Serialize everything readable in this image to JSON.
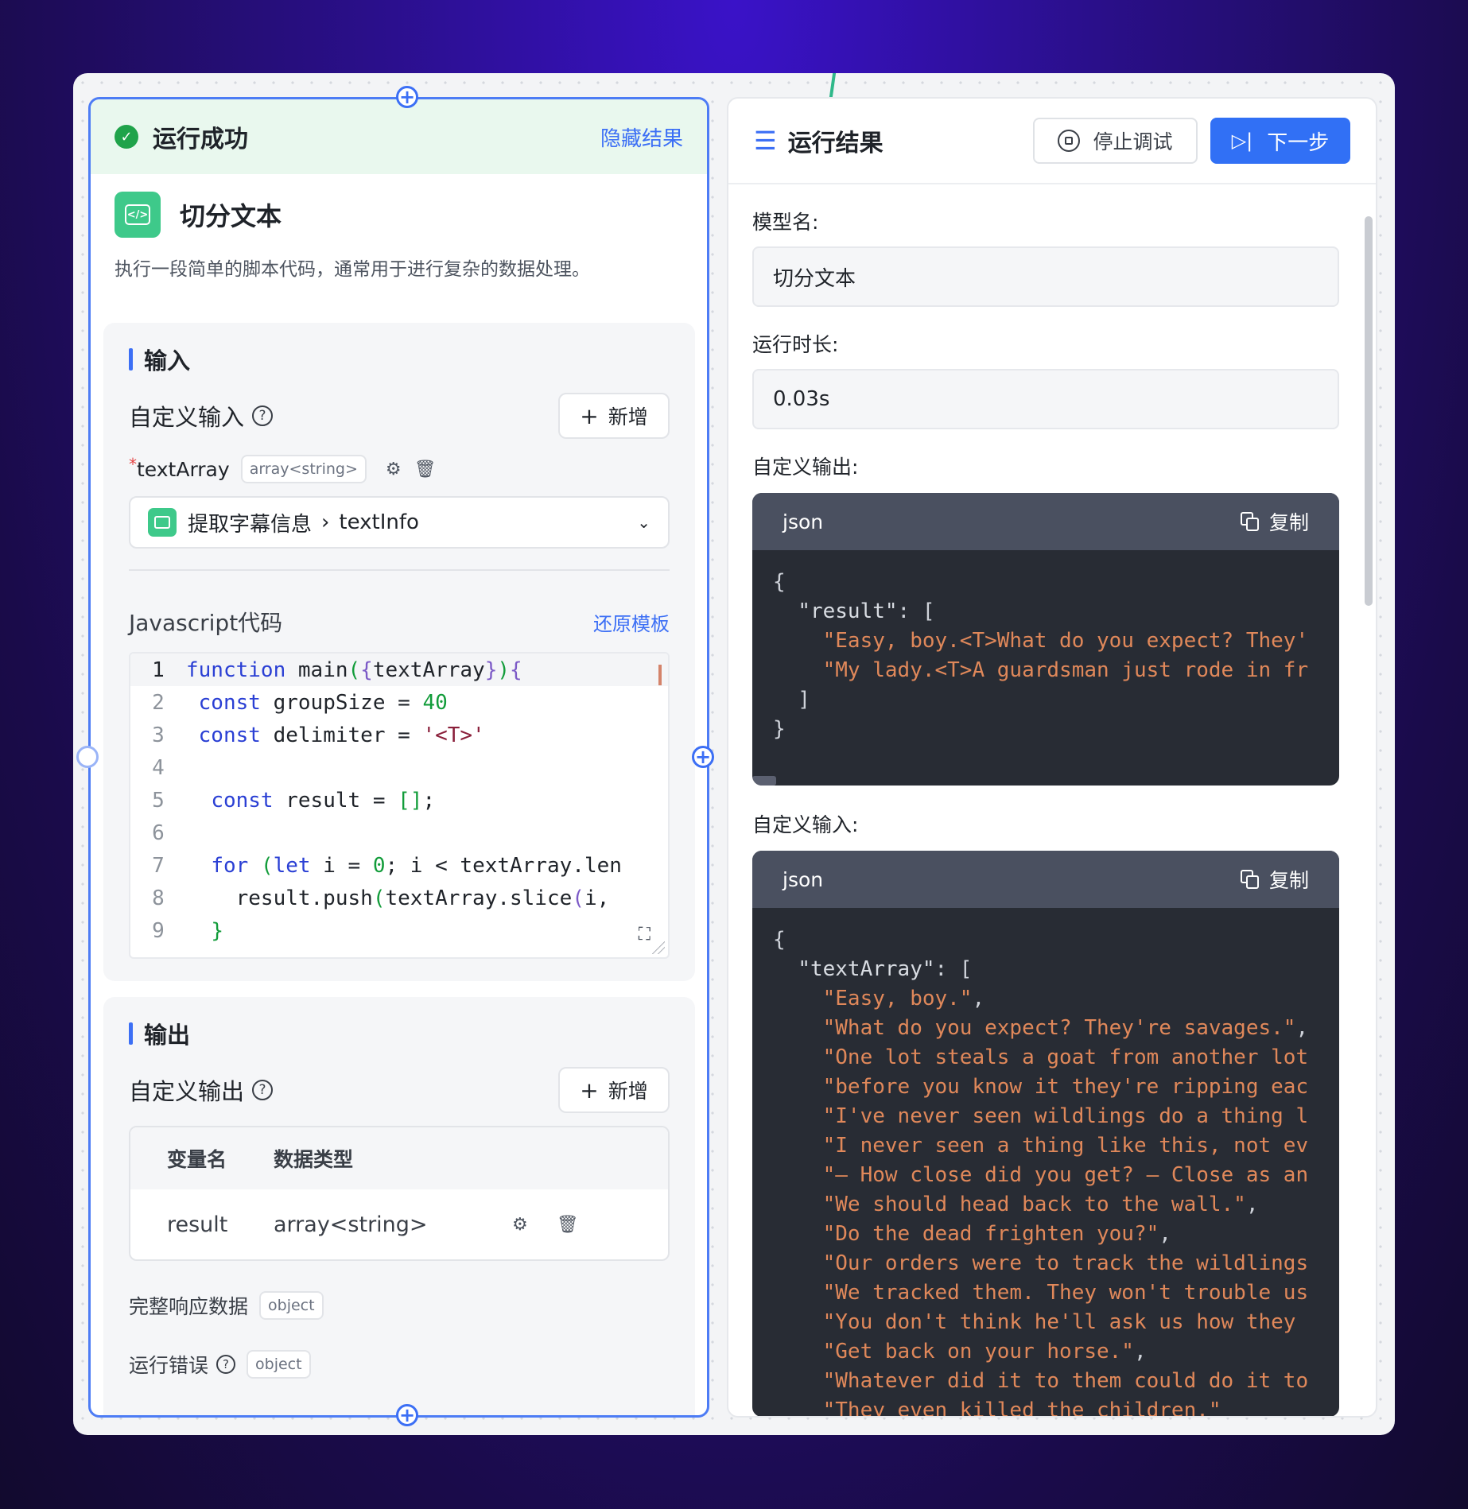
{
  "node": {
    "status": "运行成功",
    "hide_result": "隐藏结果",
    "title": "切分文本",
    "description": "执行一段简单的脚本代码，通常用于进行复杂的数据处理。",
    "input_section": "输入",
    "custom_input_label": "自定义输入",
    "add_label": "新增",
    "input_var": {
      "required_mark": "*",
      "name": "textArray",
      "type": "array<string>"
    },
    "source": {
      "node": "提取字幕信息",
      "field": "textInfo"
    },
    "code_label": "Javascript代码",
    "restore_template": "还原模板",
    "code_line_numbers": [
      "1",
      "2",
      "3",
      "4",
      "5",
      "6",
      "7",
      "8",
      "9"
    ],
    "output_section": "输出",
    "custom_output_label": "自定义输出",
    "output_table": {
      "headers": [
        "变量名",
        "数据类型"
      ],
      "rows": [
        {
          "name": "result",
          "type": "array<string>"
        }
      ]
    },
    "full_response": {
      "label": "完整响应数据",
      "type": "object"
    },
    "run_error": {
      "label": "运行错误",
      "type": "object"
    }
  },
  "result_panel": {
    "title": "运行结果",
    "stop_debug": "停止调试",
    "next_step": "下一步",
    "model_name_label": "模型名:",
    "model_name_value": "切分文本",
    "duration_label": "运行时长:",
    "duration_value": "0.03s",
    "custom_output_label": "自定义输出:",
    "custom_input_label": "自定义输入:",
    "json_label": "json",
    "copy_label": "复制"
  },
  "colors": {
    "accent": "#3170f5",
    "success": "#1fa34a",
    "code_badge": "#3ec98a"
  }
}
